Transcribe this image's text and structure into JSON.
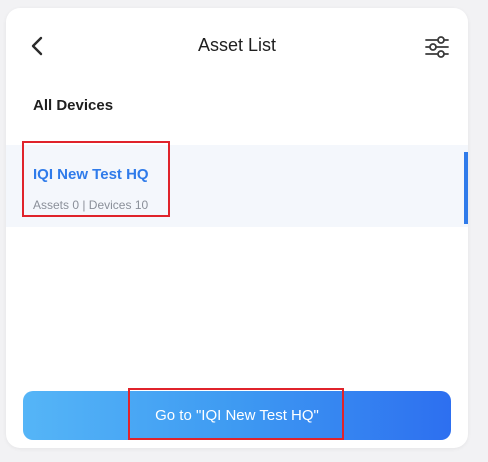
{
  "header": {
    "title": "Asset List",
    "back_icon": "chevron-left-icon",
    "filter_icon": "sliders-icon"
  },
  "section": {
    "title": "All Devices"
  },
  "list": {
    "items": [
      {
        "name": "IQI New Test HQ",
        "meta": "Assets 0 | Devices 10",
        "selected": true
      }
    ]
  },
  "footer": {
    "go_button_label": "Go to \"IQI New Test HQ\""
  },
  "colors": {
    "accent": "#2f7bea",
    "highlight": "#e0232b",
    "button_gradient_start": "#55b5f7",
    "button_gradient_end": "#2d6ff0"
  }
}
